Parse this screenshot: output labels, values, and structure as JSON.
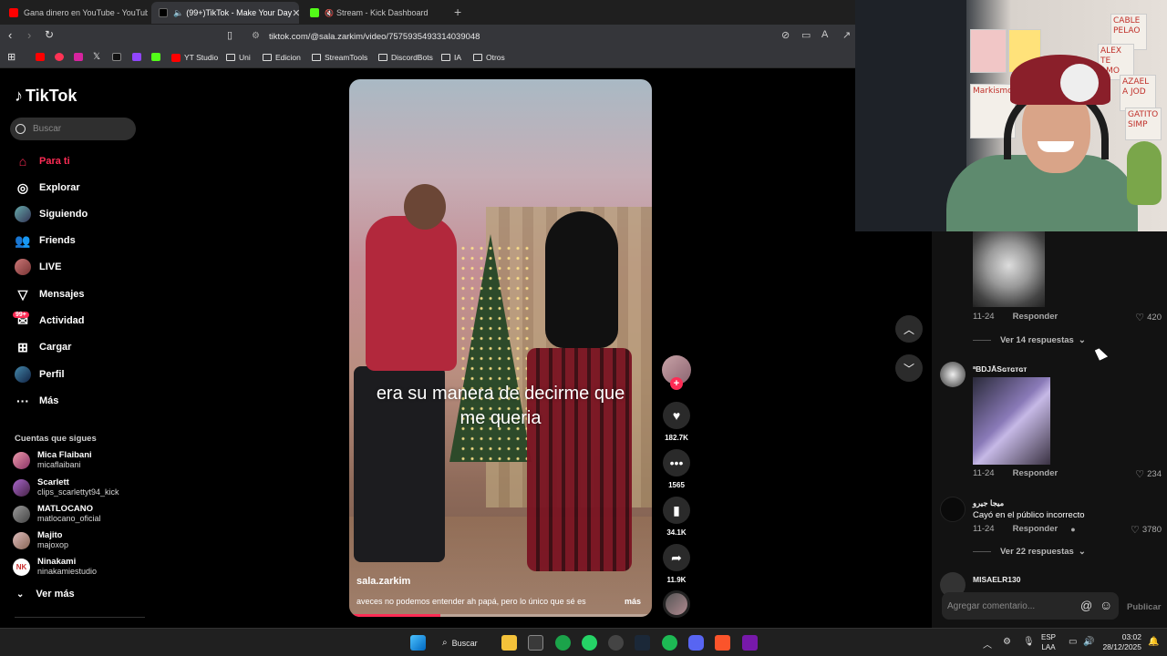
{
  "browser": {
    "tabs": [
      {
        "title": "Gana dinero en YouTube - YouTube",
        "color": "#ff0000"
      },
      {
        "title": "(99+)TikTok - Make Your Day",
        "color": "#111111"
      },
      {
        "title": "Stream - Kick Dashboard",
        "color": "#53fc18"
      }
    ],
    "url": "tiktok.com/@sala.zarkim/video/7575935493314039048",
    "bookmarks": [
      "YT Studio",
      "Uni",
      "Edicion",
      "StreamTools",
      "DiscordBots",
      "IA",
      "Otros"
    ]
  },
  "sidebar": {
    "logo": "TikTok",
    "search_placeholder": "Buscar",
    "nav": [
      {
        "label": "Para ti",
        "icon": "home-icon",
        "active": true
      },
      {
        "label": "Explorar",
        "icon": "compass-icon"
      },
      {
        "label": "Siguiendo",
        "icon": "following-avatar-icon"
      },
      {
        "label": "Friends",
        "icon": "friends-icon"
      },
      {
        "label": "LIVE",
        "icon": "live-avatar-icon"
      },
      {
        "label": "Mensajes",
        "icon": "paper-plane-icon"
      },
      {
        "label": "Actividad",
        "icon": "activity-icon"
      },
      {
        "label": "Cargar",
        "icon": "upload-icon"
      },
      {
        "label": "Perfil",
        "icon": "profile-avatar-icon"
      },
      {
        "label": "Más",
        "icon": "more-icon"
      }
    ],
    "activity_badge": "99+",
    "following_title": "Cuentas que sigues",
    "following": [
      {
        "name": "Mica Flaibani",
        "handle": "micaflaibani"
      },
      {
        "name": "Scarlett",
        "handle": "clips_scarlettyt94_kick"
      },
      {
        "name": "MATLOCANO",
        "handle": "matlocano_oficial"
      },
      {
        "name": "Majito",
        "handle": "majoxop"
      },
      {
        "name": "Ninakami",
        "handle": "ninakamiestudio"
      }
    ],
    "see_more": "Ver más"
  },
  "video": {
    "overlay_text_line1": "era su manera de decirme que",
    "overlay_text_line2": "me queria",
    "username": "sala.zarkim",
    "description": "aveces no podemos entender ah papá, pero lo único que sé es",
    "more": "más",
    "progress": 0.3
  },
  "actions": {
    "likes": "182.7K",
    "comments": "1565",
    "saves": "34.1K",
    "shares": "11.9K"
  },
  "webcam": {
    "notes": [
      "CABLE PELAO",
      "ALEX TE AMO",
      "AZAEL A JOD",
      "GATITO SIMP"
    ],
    "small_sign": "Markismo"
  },
  "comments": {
    "items": [
      {
        "date": "11-24",
        "reply": "Responder",
        "likes": "420",
        "view_replies": "Ver 14 respuestas"
      },
      {
        "user": "ªBDJĀSɢᴛɢᴛɢᴛ",
        "date": "11-24",
        "reply": "Responder",
        "likes": "234"
      },
      {
        "user": "ميجا جيرو",
        "text": "Cayó en el público incorrecto",
        "date": "11-24",
        "reply": "Responder",
        "likes": "3780",
        "view_replies": "Ver 22 respuestas"
      },
      {
        "user": "MISAELR130"
      }
    ],
    "input_placeholder": "Agregar comentario...",
    "publish": "Publicar"
  },
  "taskbar": {
    "search": "Buscar",
    "lang_line1": "ESP",
    "lang_line2": "LAA",
    "time": "03:02",
    "date": "28/12/2025"
  },
  "colors": {
    "accent": "#fe2c55",
    "panel": "#121212"
  }
}
